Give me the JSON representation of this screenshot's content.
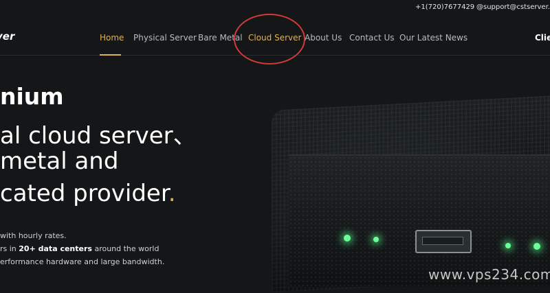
{
  "topbar": {
    "phone": "+1(720)7677429",
    "email": "@support@cstserver.com"
  },
  "header": {
    "logo_text": "ver",
    "nav": [
      {
        "label": "Home",
        "active": true
      },
      {
        "label": "Physical Server",
        "active": false
      },
      {
        "label": "Bare Metal",
        "active": false
      },
      {
        "label": "Cloud Server",
        "active": false
      },
      {
        "label": "About Us",
        "active": false
      },
      {
        "label": "Contact Us",
        "active": false
      },
      {
        "label": "Our Latest News",
        "active": false
      }
    ],
    "client_label": "Clie"
  },
  "hero": {
    "line1": "nium",
    "line2": "al cloud server、",
    "line3": " metal and",
    "line4_text": "cated provider",
    "line4_dot": ".",
    "bullets": {
      "b1": "with hourly rates.",
      "b2_prefix": "rs in ",
      "b2_bold": "20+ data centers",
      "b2_suffix": " around the world",
      "b3": "erformance hardware and large bandwidth."
    }
  },
  "watermark": "www.vps234.com",
  "colors": {
    "accent": "#e0b25a",
    "annotation": "#d63a3a",
    "background": "#141618"
  }
}
